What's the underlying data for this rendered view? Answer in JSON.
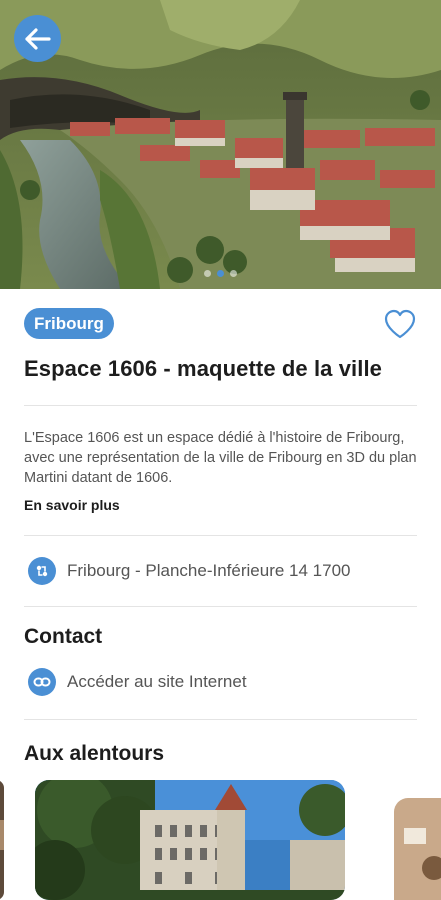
{
  "header": {
    "back_icon": "arrow-left-icon",
    "carousel_count": 3,
    "carousel_active": 0
  },
  "place": {
    "city_tag": "Fribourg",
    "title": "Espace 1606 - maquette de la ville",
    "description": "L'Espace 1606 est un espace dédié à l'histoire de Fribourg, avec une représentation de la ville de Fribourg en 3D du plan Martini datant de 1606.",
    "more_label": "En savoir plus",
    "address": "Fribourg - Planche-Inférieure 14 1700",
    "favorite_icon": "heart-outline-icon"
  },
  "contact": {
    "title": "Contact",
    "website_label": "Accéder au site Internet",
    "website_icon": "link-icon"
  },
  "nearby": {
    "title": "Aux alentours"
  },
  "colors": {
    "accent": "#4a8fd4",
    "text": "#1d1d1d",
    "muted": "#555555",
    "divider": "#e4e4e4"
  }
}
